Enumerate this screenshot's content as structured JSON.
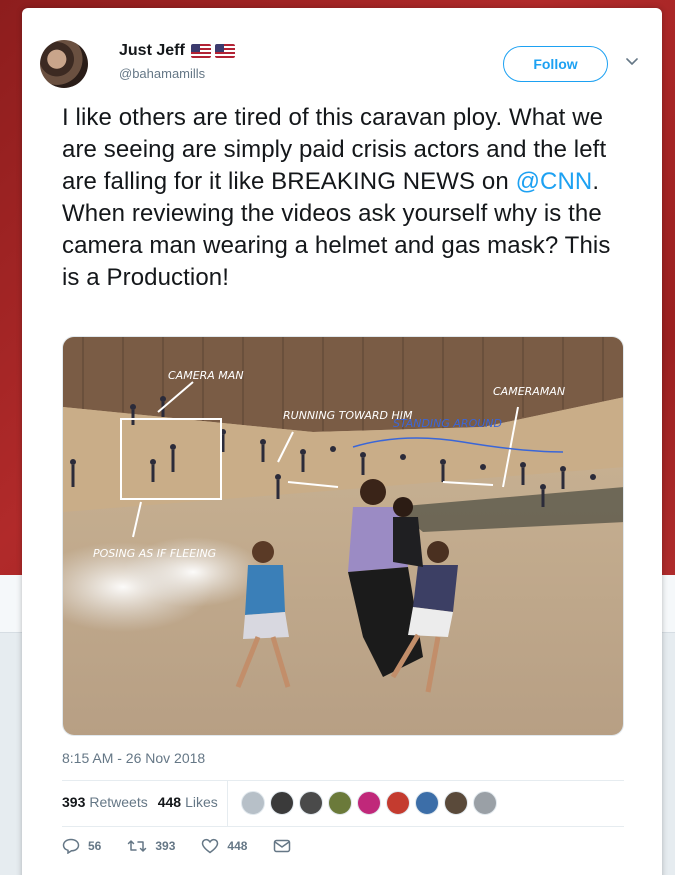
{
  "user": {
    "display_name": "Just Jeff",
    "handle": "@bahamamills",
    "flag_emojis": [
      "us-flag-icon",
      "us-flag-icon"
    ]
  },
  "follow_label": "Follow",
  "tweet": {
    "text_part1": "I like others are tired of this caravan ploy. What we are seeing are simply paid crisis actors and the left are falling for it like BREAKING NEWS on ",
    "mention": "@CNN",
    "text_part2": ".   When reviewing the videos ask yourself why is the camera man wearing a helmet and gas mask?  This is a Production!"
  },
  "photo_annotations": {
    "camera_man_left": "CAMERA MAN",
    "running_toward": "RUNNING TOWARD HIM",
    "standing_around": "STANDING AROUND",
    "camera_man_right": "CAMERAMAN",
    "posing": "POSING AS IF FLEEING"
  },
  "timestamp": "8:15 AM - 26 Nov 2018",
  "stats": {
    "retweets_count": "393",
    "retweets_label": "Retweets",
    "likes_count": "448",
    "likes_label": "Likes"
  },
  "liker_avatars": [
    "#b7c0c8",
    "#3a3a3a",
    "#4a4a4a",
    "#6b7a3a",
    "#c0287a",
    "#c43b2f",
    "#3c6ea8",
    "#5a4a3a",
    "#9aa0a6"
  ],
  "actions": {
    "replies": "56",
    "retweets": "393",
    "likes": "448"
  },
  "colors": {
    "accent": "#1da1f2",
    "text": "#14171a",
    "muted": "#657786"
  }
}
